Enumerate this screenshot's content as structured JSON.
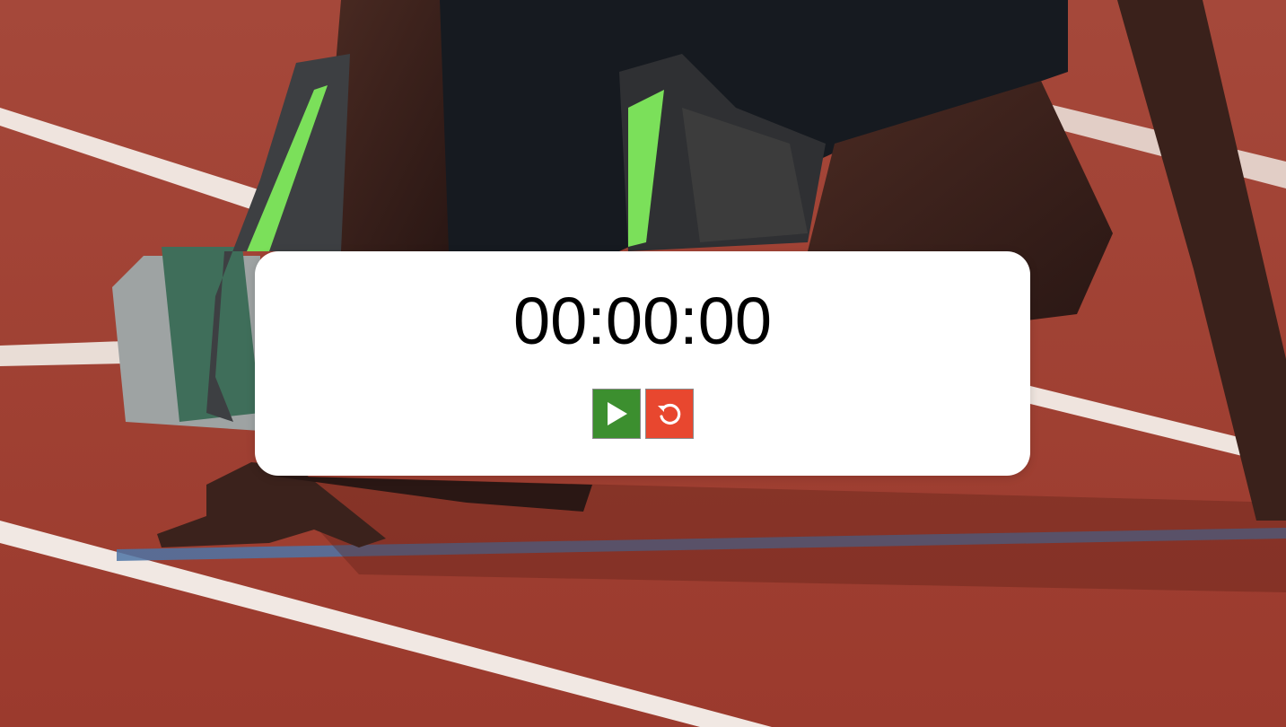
{
  "stopwatch": {
    "time": "00:00:00"
  },
  "controls": {
    "start": {
      "icon": "play-icon",
      "color": "#3c8f2f"
    },
    "reset": {
      "icon": "reset-icon",
      "color": "#e8472f"
    }
  },
  "background": {
    "icon": "running-track-photo",
    "track_color": "#9a3a2c"
  }
}
